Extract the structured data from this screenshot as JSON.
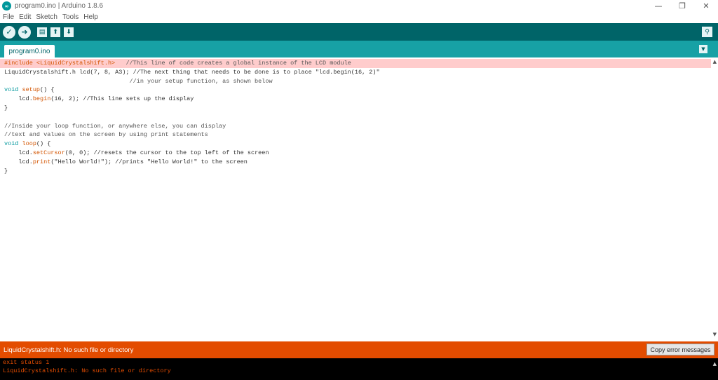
{
  "window": {
    "title": "program0.ino | Arduino 1.8.6",
    "minimize": "—",
    "maximize": "❐",
    "close": "✕"
  },
  "menu": [
    "File",
    "Edit",
    "Sketch",
    "Tools",
    "Help"
  ],
  "toolbar": {
    "verify_icon": "✓",
    "upload_icon": "➜",
    "new_icon": "▤",
    "open_icon": "⬆",
    "save_icon": "⬇",
    "serial_monitor_icon": "⚲"
  },
  "tab": {
    "label": "program0.ino",
    "menu_icon": "▼"
  },
  "code": {
    "line1": {
      "pre": "#include ",
      "lib": "<LiquidCrystalshift.h>",
      "comment": "   //This line of code creates a global instance of the LCD module"
    },
    "line2": {
      "text": "LiquidCrystalshift.h lcd(7, 8, A3); //The next thing that needs to be done is to place \"lcd.begin(16, 2)\""
    },
    "line3": {
      "text": "                                   //in your setup function, as shown below"
    },
    "line4": {
      "kw": "void",
      "fn": "setup",
      "rest": "() {"
    },
    "line5": {
      "pre": "    lcd.",
      "fn": "begin",
      "rest": "(16, 2); //This line sets up the display"
    },
    "line6": {
      "text": "}"
    },
    "line7": {
      "text": ""
    },
    "line8": {
      "text": "//Inside your loop function, or anywhere else, you can display"
    },
    "line9": {
      "text": "//text and values on the screen by using print statements"
    },
    "line10": {
      "kw": "void",
      "fn": "loop",
      "rest": "() {"
    },
    "line11": {
      "pre": "    lcd.",
      "fn": "setCursor",
      "rest": "(0, 0); //resets the cursor to the top left of the screen"
    },
    "line12": {
      "pre": "    lcd.",
      "fn": "print",
      "rest": "(\"Hello World!\"); //prints \"Hello World!\" to the screen"
    },
    "line13": {
      "text": "}"
    }
  },
  "status": {
    "message": "LiquidCrystalshift.h: No such file or directory",
    "copy_button": "Copy error messages",
    "color": "#e34c00"
  },
  "console": {
    "lines": [
      "exit status 1",
      "LiquidCrystalshift.h: No such file or directory"
    ]
  },
  "colors": {
    "toolbar": "#006468",
    "tabbar": "#17a1a5",
    "error_highlight": "#ffcccc"
  }
}
